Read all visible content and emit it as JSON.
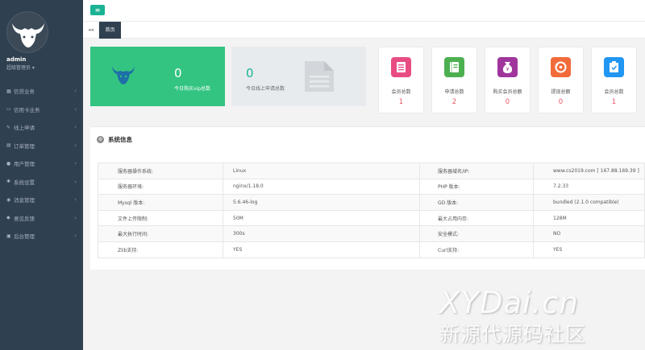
{
  "user": {
    "name": "admin",
    "role": "超级管理员 ▾"
  },
  "sidebar": {
    "items": [
      {
        "label": "信贷业务",
        "icon": "calendar-icon"
      },
      {
        "label": "信用卡业务",
        "icon": "credit-card-icon"
      },
      {
        "label": "线上申请",
        "icon": "edit-icon"
      },
      {
        "label": "订单管理",
        "icon": "table-icon"
      },
      {
        "label": "用户管理",
        "icon": "user-icon"
      },
      {
        "label": "系统设置",
        "icon": "gears-icon"
      },
      {
        "label": "消息管理",
        "icon": "comment-icon"
      },
      {
        "label": "意见反馈",
        "icon": "tag-icon"
      },
      {
        "label": "后台管理",
        "icon": "desktop-icon"
      }
    ]
  },
  "header": {
    "menu_icon": "≡"
  },
  "tabs": {
    "prev": "◂◂",
    "home": "首页"
  },
  "stats": {
    "vip": {
      "value": "0",
      "label": "今日购买vip总数"
    },
    "apply": {
      "value": "0",
      "label": "今日线上申请总数"
    },
    "mini": [
      {
        "label": "会员总数",
        "value": "1",
        "color": "#e84c83"
      },
      {
        "label": "申请总数",
        "value": "2",
        "color": "#4caf50"
      },
      {
        "label": "购买会员总额",
        "value": "0",
        "color": "#a0359c"
      },
      {
        "label": "提现总额",
        "value": "0",
        "color": "#f26b3a"
      },
      {
        "label": "会员总数",
        "value": "1",
        "color": "#2196f3"
      }
    ]
  },
  "system": {
    "title": "系统信息",
    "rows": [
      [
        "服务器操作系统:",
        "Linux",
        "服务器域名/IP:",
        "www.cs2019.com [ 167.88.169.39 ]"
      ],
      [
        "服务器环境:",
        "nginx/1.18.0",
        "PHP 版本:",
        "7.2.33"
      ],
      [
        "Mysql 版本:",
        "5.6.46-log",
        "GD 版本:",
        "bundled (2.1.0 compatible)"
      ],
      [
        "文件上传限制:",
        "50M",
        "最大占用内存:",
        "128M"
      ],
      [
        "最大执行时间:",
        "300s",
        "安全模式:",
        "NO"
      ],
      [
        "Zlib支持:",
        "YES",
        "Curl支持:",
        "YES"
      ]
    ]
  },
  "watermark": {
    "line1": "XYDai.cn",
    "line2": "新源代源码社区"
  }
}
